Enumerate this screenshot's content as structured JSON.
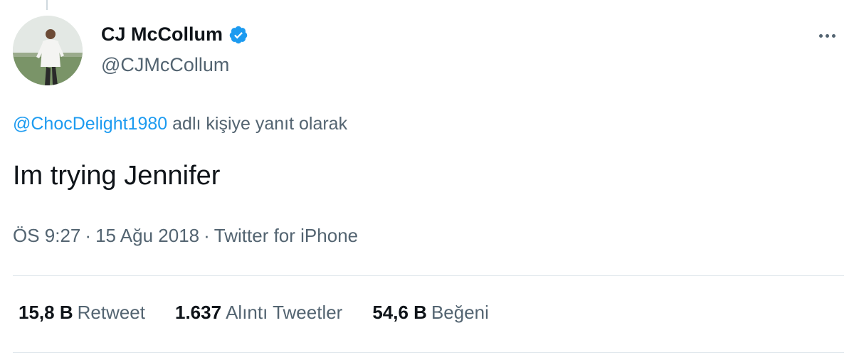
{
  "author": {
    "display_name": "CJ McCollum",
    "handle": "@CJMcCollum",
    "verified": true
  },
  "reply_context": {
    "mention": "@ChocDelight1980",
    "suffix": "adlı kişiye yanıt olarak"
  },
  "tweet": {
    "text": "Im trying Jennifer"
  },
  "meta": {
    "time": "ÖS 9:27",
    "separator": "·",
    "date": "15 Ağu 2018",
    "source": "Twitter for iPhone"
  },
  "stats": [
    {
      "value": "15,8 B",
      "label": "Retweet"
    },
    {
      "value": "1.637",
      "label": "Alıntı Tweetler"
    },
    {
      "value": "54,6 B",
      "label": "Beğeni"
    }
  ],
  "colors": {
    "accent": "#1d9bf0",
    "text_primary": "#0f1419",
    "text_secondary": "#536471",
    "divider": "#e1e8ed"
  },
  "icons": {
    "verified": "verified-badge-icon",
    "more": "more-horizontal-icon"
  }
}
